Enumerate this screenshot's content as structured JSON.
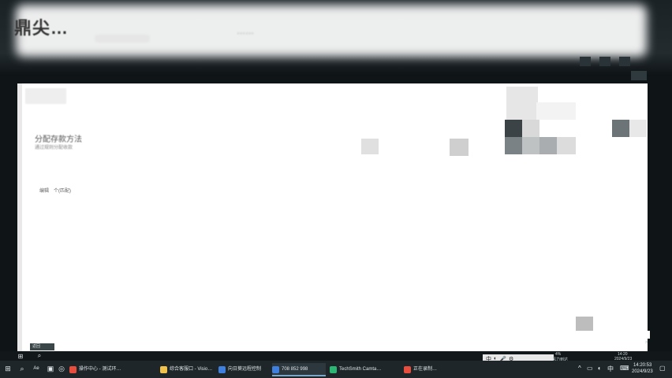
{
  "header": {
    "brand": "鼎尖",
    "brand_suffix": "…",
    "subtitle": "……"
  },
  "content": {
    "title": "分配存款方法",
    "subtitle": "通过规则分配收款",
    "row_a": "编辑",
    "row_b": "个(匹配)"
  },
  "bottom_tag": "返回",
  "mini_tray": {
    "ime_label": "中",
    "temp": "4%",
    "temp_sub": "风力到达",
    "time": "14:20",
    "date": "2024/9/23"
  },
  "taskbar": {
    "buttons": [
      {
        "label": "操作中心 - 测试环…",
        "color": "#e84d3d"
      },
      {
        "label": "综合客服口 - Visio…",
        "color": "#f0c14b"
      },
      {
        "label": "向日葵远程控制",
        "color": "#3f7fdd"
      },
      {
        "label": "708 852 998",
        "color": "#3f7fdd"
      },
      {
        "label": "TechSmith Camta…",
        "color": "#2bb673"
      },
      {
        "label": "正在录制…",
        "color": "#e84d3d"
      }
    ],
    "time": "14:20:53",
    "date": "2024/9/23"
  },
  "colors": {
    "taskbar_bg": "#1e2629",
    "content_bg": "#ffffff",
    "accent": "#7aa7c7"
  }
}
